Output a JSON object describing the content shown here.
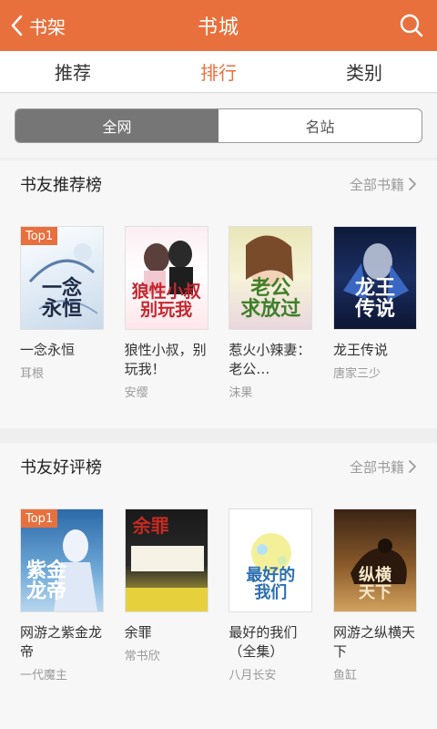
{
  "topbar": {
    "back_label": "书架",
    "title": "书城",
    "search_icon": "search-icon",
    "back_icon": "chevron-left-icon"
  },
  "tabs": [
    {
      "label": "推荐",
      "active": false
    },
    {
      "label": "排行",
      "active": true
    },
    {
      "label": "类别",
      "active": false
    }
  ],
  "segment": [
    {
      "label": "全网",
      "active": true
    },
    {
      "label": "名站",
      "active": false
    }
  ],
  "colors": {
    "accent": "#e8703d",
    "segment_active": "#767676"
  },
  "sections": [
    {
      "title": "书友推荐榜",
      "more_label": "全部书籍",
      "books": [
        {
          "badge": "Top1",
          "title": "一念永恒",
          "author": "耳根",
          "cover_text": "一念\n永恒"
        },
        {
          "badge": "",
          "title": "狼性小叔，别玩我！",
          "author": "安缨",
          "cover_text": "狼性小叔\n别玩我"
        },
        {
          "badge": "",
          "title": "惹火小辣妻：老公…",
          "author": "沫果",
          "cover_text": "老公\n求放过"
        },
        {
          "badge": "",
          "title": "龙王传说",
          "author": "唐家三少",
          "cover_text": "龙王\n传说"
        }
      ]
    },
    {
      "title": "书友好评榜",
      "more_label": "全部书籍",
      "books": [
        {
          "badge": "Top1",
          "title": "网游之紫金龙帝",
          "author": "一代魔主",
          "cover_text": "紫金\n龙帝"
        },
        {
          "badge": "",
          "title": "余罪",
          "author": "常书欣",
          "cover_text": "余罪"
        },
        {
          "badge": "",
          "title": "最好的我们（全集）",
          "author": "八月长安",
          "cover_text": "最好的\n我们"
        },
        {
          "badge": "",
          "title": "网游之纵横天下",
          "author": "鱼缸",
          "cover_text": "纵横\n天下"
        }
      ]
    }
  ]
}
